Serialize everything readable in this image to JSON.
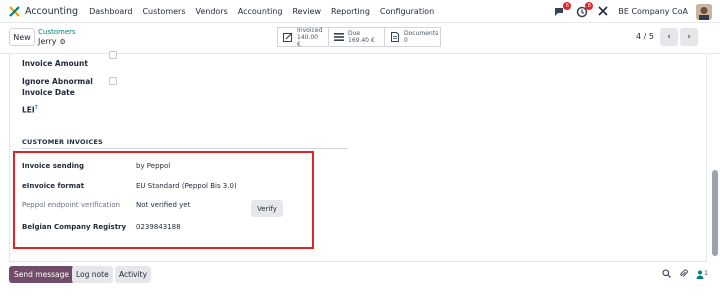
{
  "navbar": {
    "app_name": "Accounting",
    "menu": [
      "Dashboard",
      "Customers",
      "Vendors",
      "Accounting",
      "Review",
      "Reporting",
      "Configuration"
    ],
    "messages_badge": "6",
    "activities_badge": "8",
    "company": "BE Company CoA"
  },
  "control": {
    "new_label": "New",
    "breadcrumb_parent": "Customers",
    "breadcrumb_current": "Jerry",
    "smart_buttons": [
      {
        "label": "Invoiced",
        "value": "140.00 €"
      },
      {
        "label": "Due",
        "value": "169.40 €"
      },
      {
        "label": "Documents",
        "value": "0"
      }
    ],
    "pager": "4 / 5"
  },
  "form": {
    "invoice_amount_label": "Invoice Amount",
    "ignore_abnormal_label": "Ignore Abnormal",
    "ignore_abnormal_label_2": "Invoice Date",
    "lei_label": "LEI",
    "lei_help": "?",
    "section_title": "CUSTOMER INVOICES",
    "rows": [
      {
        "label": "Invoice sending",
        "value": "by Peppol"
      },
      {
        "label": "eInvoice format",
        "value": "EU Standard (Peppol Bis 3.0)"
      },
      {
        "label": "Peppol endpoint verification",
        "value": "Not verified yet"
      },
      {
        "label": "Belgian Company Registry",
        "value": "0239843188"
      }
    ],
    "verify_label": "Verify"
  },
  "chatter": {
    "send_message": "Send message",
    "log_note": "Log note",
    "activity": "Activity",
    "followers": "1"
  },
  "colors": {
    "brand": "#714b67",
    "accent": "#017e84",
    "highlight": "#e02424"
  }
}
